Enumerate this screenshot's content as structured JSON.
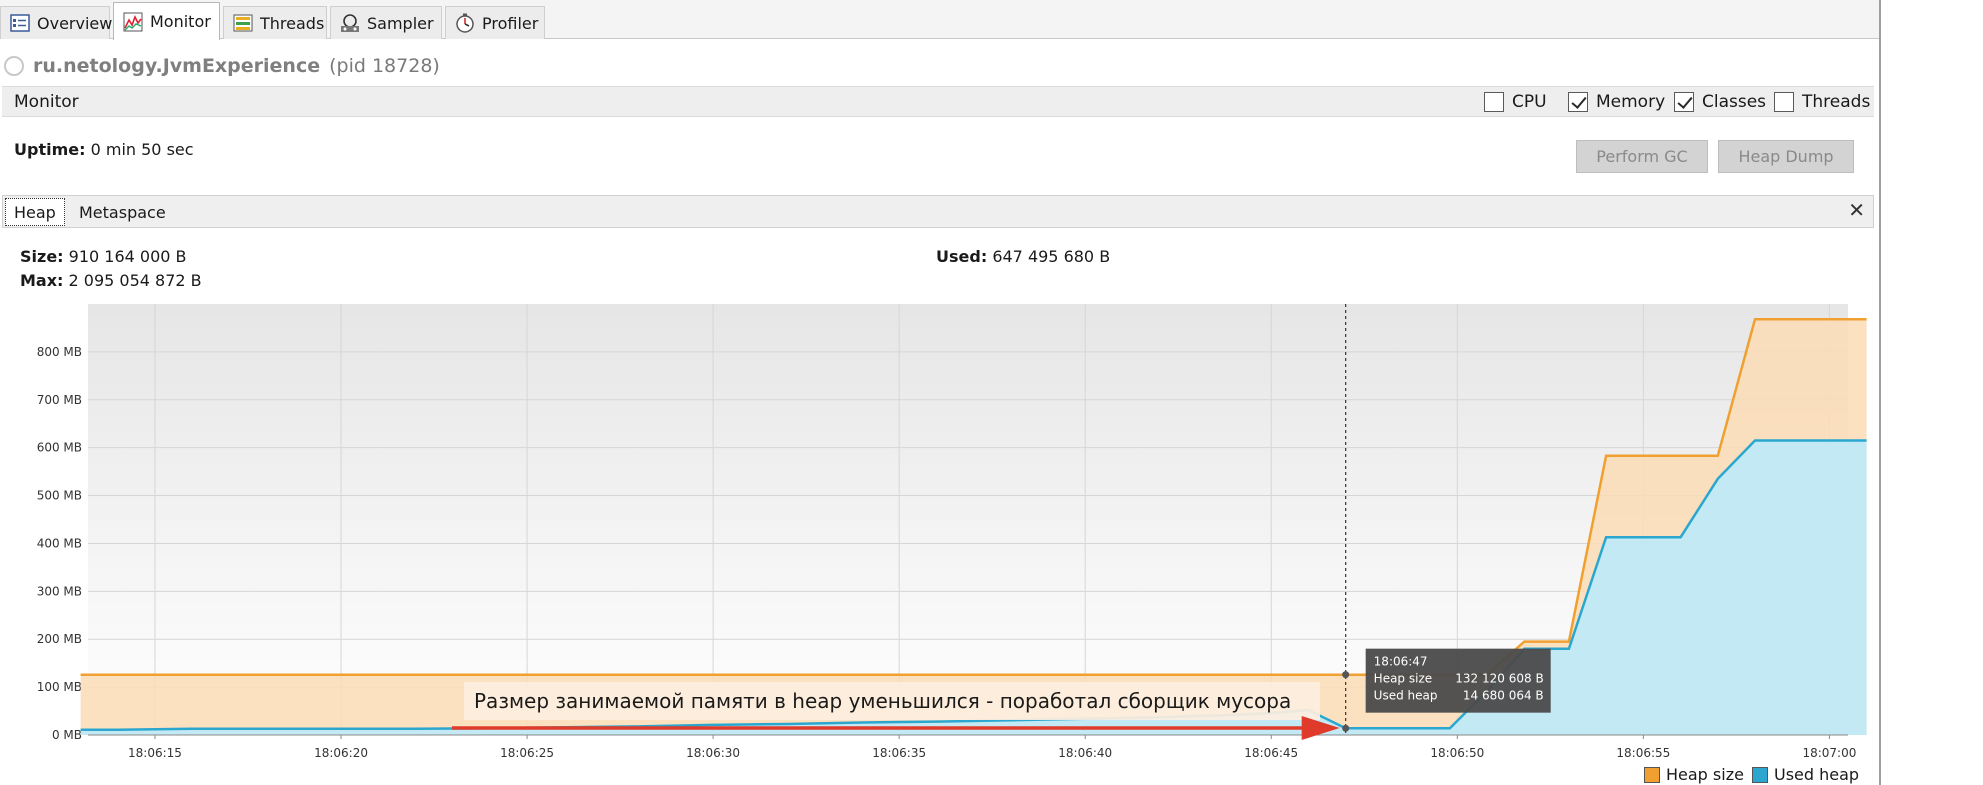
{
  "tabs": [
    {
      "label": "Overview",
      "icon": "overview-icon",
      "active": false
    },
    {
      "label": "Monitor",
      "icon": "monitor-icon",
      "active": true
    },
    {
      "label": "Threads",
      "icon": "threads-icon",
      "active": false
    },
    {
      "label": "Sampler",
      "icon": "sampler-icon",
      "active": false
    },
    {
      "label": "Profiler",
      "icon": "profiler-icon",
      "active": false
    }
  ],
  "app": {
    "name": "ru.netology.JvmExperience",
    "pid": "(pid 18728)"
  },
  "monitor": {
    "title": "Monitor",
    "checkboxes": [
      {
        "label": "CPU",
        "checked": false
      },
      {
        "label": "Memory",
        "checked": true
      },
      {
        "label": "Classes",
        "checked": true
      },
      {
        "label": "Threads",
        "checked": false
      }
    ],
    "uptime_label": "Uptime:",
    "uptime_value": "0 min 50 sec",
    "perform_gc": "Perform GC",
    "heap_dump": "Heap Dump"
  },
  "subtabs": {
    "heap": "Heap",
    "metaspace": "Metaspace",
    "close": "✕"
  },
  "stats": {
    "size_label": "Size:",
    "size_value": "910 164 000 B",
    "max_label": "Max:",
    "max_value": "2 095 054 872 B",
    "used_label": "Used:",
    "used_value": "647 495 680 B"
  },
  "tooltip": {
    "time": "18:06:47",
    "heap_label": "Heap size",
    "heap_value": "132 120 608 B",
    "used_label": "Used heap",
    "used_value": "14 680 064 B"
  },
  "annotation": "Размер занимаемой памяти в heap уменьшился - поработал сборщик мусора",
  "legend": {
    "heap": "Heap size",
    "used": "Used heap"
  },
  "colors": {
    "heap_line": "#f0a030",
    "heap_fill": "#fbdcb5",
    "used_line": "#2ba7cf",
    "used_fill": "#bfe9f7",
    "arrow": "#e03a2a",
    "tooltip_bg": "#4a4a4a"
  },
  "chart_data": {
    "type": "area",
    "x": [
      "18:06:13",
      "18:06:14",
      "18:06:16",
      "18:06:18",
      "18:06:20",
      "18:06:22",
      "18:06:24",
      "18:06:26",
      "18:06:28",
      "18:06:30",
      "18:06:32",
      "18:06:34",
      "18:06:36",
      "18:06:38",
      "18:06:40",
      "18:06:42",
      "18:06:44",
      "18:06:45",
      "18:06:46",
      "18:06:47",
      "18:06:48",
      "18:06:49",
      "18:06:49.8",
      "18:06:50.8",
      "18:06:51.8",
      "18:06:53",
      "18:06:54",
      "18:06:55",
      "18:06:56",
      "18:06:57",
      "18:06:58",
      "18:06:59",
      "18:07:00",
      "18:07:01"
    ],
    "series": [
      {
        "name": "Heap size",
        "values": [
          126,
          126,
          126,
          126,
          126,
          126,
          126,
          126,
          126,
          126,
          126,
          126,
          126,
          126,
          126,
          126,
          126,
          126,
          126,
          126,
          126,
          126,
          126,
          126,
          195,
          195,
          583,
          583,
          583,
          583,
          868,
          868,
          868,
          868
        ]
      },
      {
        "name": "Used heap",
        "values": [
          11,
          11,
          13,
          13,
          13,
          13,
          14,
          16,
          18,
          21,
          23,
          26,
          28,
          31,
          34,
          37,
          42,
          46,
          52,
          14,
          14,
          14,
          14,
          92,
          180,
          180,
          413,
          413,
          413,
          535,
          615,
          615,
          615,
          615
        ]
      }
    ],
    "x_ticks": [
      "18:06:15",
      "18:06:20",
      "18:06:25",
      "18:06:30",
      "18:06:35",
      "18:06:40",
      "18:06:45",
      "18:06:50",
      "18:06:55",
      "18:07:00"
    ],
    "y_ticks": [
      "0 MB",
      "100 MB",
      "200 MB",
      "300 MB",
      "400 MB",
      "500 MB",
      "600 MB",
      "700 MB",
      "800 MB"
    ],
    "ylim": [
      0,
      900
    ],
    "xlim_seconds": [
      13.2,
      60.5
    ],
    "grid": true,
    "legend_position": "bottom-right",
    "cursor_time": "18:06:47"
  }
}
